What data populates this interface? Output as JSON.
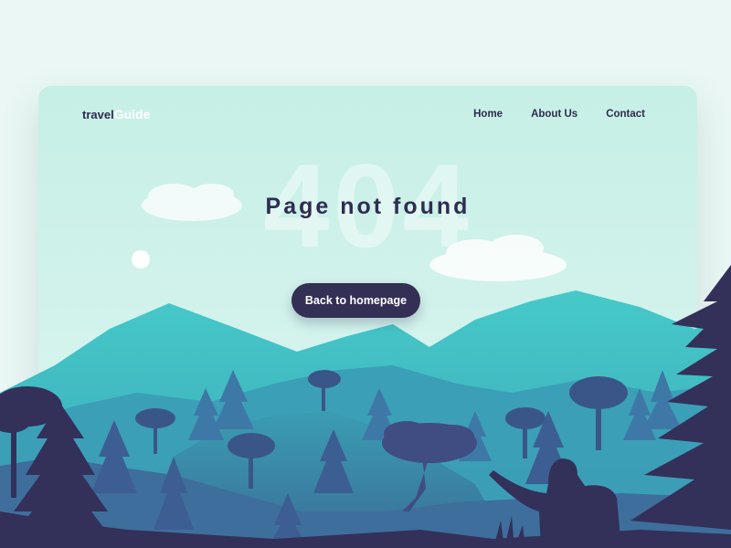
{
  "brand": {
    "prefix": "travel",
    "accent": "Guide"
  },
  "nav": {
    "items": [
      {
        "label": "Home"
      },
      {
        "label": "About Us"
      },
      {
        "label": "Contact"
      }
    ]
  },
  "hero": {
    "code": "404",
    "title": "Page not found",
    "button_label": "Back to homepage"
  },
  "colors": {
    "background": "#eaf7f4",
    "card_top": "#c6efe6",
    "text_dark": "#302c52",
    "button": "#342f55",
    "mountain": "#46c8c8",
    "tree_dark": "#33305a",
    "tree_mid": "#3f6591"
  }
}
